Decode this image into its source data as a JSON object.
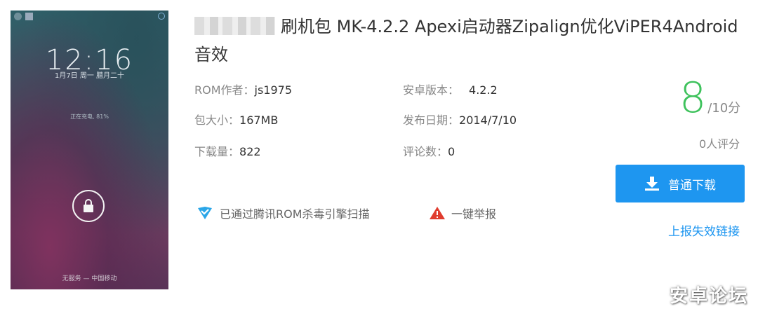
{
  "phone": {
    "time": "12:16",
    "date": "1月7日 周一   腊月二十",
    "charging": "正在充电, 81%",
    "carrier": "无服务 — 中国移动"
  },
  "title": "刷机包 MK-4.2.2 Apexi启动器Zipalign优化ViPER4Android音效",
  "info": {
    "author_label": "ROM作者：",
    "author": "js1975",
    "android_label": "安卓版本：",
    "android": "4.2.2",
    "size_label": "包大小：",
    "size": "167MB",
    "date_label": "发布日期：",
    "date": "2014/7/10",
    "downloads_label": "下载量：",
    "downloads": "822",
    "comments_label": "评论数：",
    "comments": "0"
  },
  "security": {
    "text": "已通过腾讯ROM杀毒引擎扫描"
  },
  "report": {
    "text": "一键举报"
  },
  "score": {
    "value": "8",
    "unit": "/10分",
    "count": "0人评分"
  },
  "download_button": "普通下载",
  "report_link": "上报失效链接",
  "watermark": "安卓论坛",
  "colors": {
    "accent": "#1e96f0",
    "score": "#3ec25c",
    "warning": "#e03c2e"
  }
}
